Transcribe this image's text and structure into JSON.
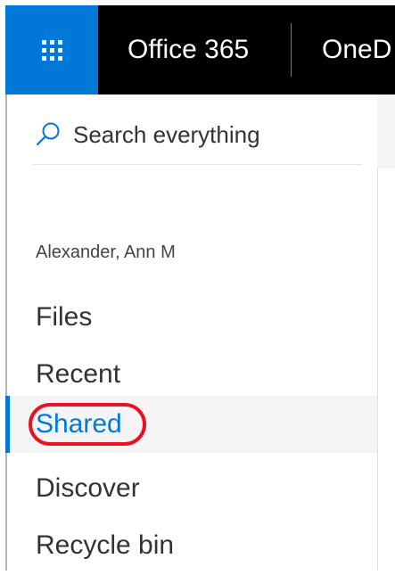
{
  "header": {
    "waffle_icon": "app-launcher-waffle-icon",
    "brand": "Office 365",
    "app_name": "OneD",
    "colors": {
      "bar": "#000000",
      "waffle": "#0078d7",
      "text": "#ffffff"
    }
  },
  "search": {
    "icon": "search-icon",
    "placeholder": "Search everything"
  },
  "user": {
    "name": "Alexander, Ann M"
  },
  "nav": {
    "items": [
      {
        "label": "Files",
        "selected": false
      },
      {
        "label": "Recent",
        "selected": false
      },
      {
        "label": "Shared",
        "selected": true
      },
      {
        "label": "Discover",
        "selected": false
      },
      {
        "label": "Recycle bin",
        "selected": false
      }
    ],
    "colors": {
      "accent": "#0078d7",
      "selected_bg": "#f4f4f4",
      "annotation": "#e81123"
    }
  }
}
